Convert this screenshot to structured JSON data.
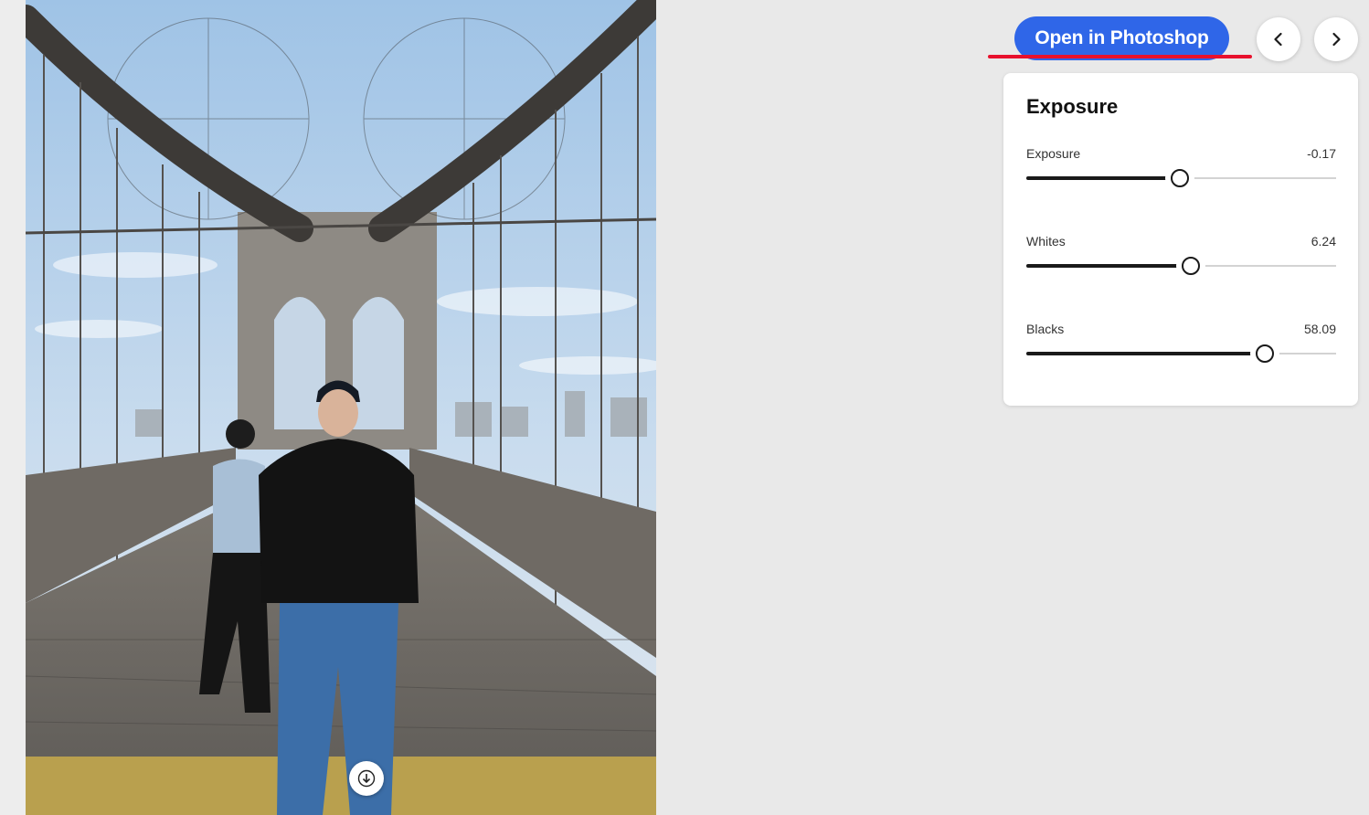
{
  "toolbar": {
    "open_in_photoshop_label": "Open in Photoshop",
    "prev_icon": "chevron-left-icon",
    "next_icon": "chevron-right-icon",
    "accent_color": "#2f66e8",
    "annotation_color": "#e8112d"
  },
  "photo": {
    "download_icon": "download-arrow-icon"
  },
  "panel": {
    "title": "Exposure",
    "sliders": [
      {
        "label": "Exposure",
        "value": "-0.17",
        "fraction": 0.495
      },
      {
        "label": "Whites",
        "value": "6.24",
        "fraction": 0.53
      },
      {
        "label": "Blacks",
        "value": "58.09",
        "fraction": 0.77
      }
    ]
  }
}
